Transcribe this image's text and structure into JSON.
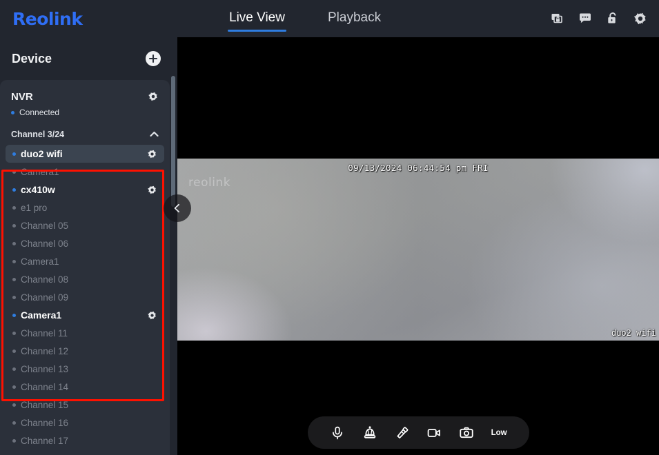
{
  "app": {
    "logo_text": "Reolink"
  },
  "header": {
    "tabs": [
      {
        "label": "Live View",
        "active": true
      },
      {
        "label": "Playback",
        "active": false
      }
    ],
    "icons": [
      {
        "name": "screen-lock-icon"
      },
      {
        "name": "chat-bubble-icon"
      },
      {
        "name": "unlocked-padlock-icon"
      },
      {
        "name": "gear-icon"
      }
    ]
  },
  "sidebar": {
    "title": "Device",
    "add_button_label": "+",
    "nvr": {
      "name": "NVR",
      "status": "Connected",
      "status_online": true
    },
    "channel_group": {
      "label": "Channel 3/24",
      "expanded": true
    },
    "channels": [
      {
        "label": "duo2 wifi",
        "active": true,
        "selected": true,
        "gear": true
      },
      {
        "label": "Camera1",
        "active": false,
        "selected": false,
        "gear": false
      },
      {
        "label": "cx410w",
        "active": true,
        "selected": false,
        "gear": true
      },
      {
        "label": "e1 pro",
        "active": false,
        "selected": false,
        "gear": false
      },
      {
        "label": "Channel 05",
        "active": false,
        "selected": false,
        "gear": false
      },
      {
        "label": "Channel 06",
        "active": false,
        "selected": false,
        "gear": false
      },
      {
        "label": "Camera1",
        "active": false,
        "selected": false,
        "gear": false
      },
      {
        "label": "Channel 08",
        "active": false,
        "selected": false,
        "gear": false
      },
      {
        "label": "Channel 09",
        "active": false,
        "selected": false,
        "gear": false
      },
      {
        "label": "Camera1",
        "active": true,
        "selected": false,
        "gear": true
      },
      {
        "label": "Channel 11",
        "active": false,
        "selected": false,
        "gear": false
      },
      {
        "label": "Channel 12",
        "active": false,
        "selected": false,
        "gear": false
      },
      {
        "label": "Channel 13",
        "active": false,
        "selected": false,
        "gear": false
      },
      {
        "label": "Channel 14",
        "active": false,
        "selected": false,
        "gear": false
      },
      {
        "label": "Channel 15",
        "active": false,
        "selected": false,
        "gear": false
      },
      {
        "label": "Channel 16",
        "active": false,
        "selected": false,
        "gear": false
      },
      {
        "label": "Channel 17",
        "active": false,
        "selected": false,
        "gear": false
      }
    ]
  },
  "video": {
    "timestamp": "09/13/2024 06:44:54 pm FRI",
    "channel_name": "duo2 wifi",
    "watermark": "reolink"
  },
  "toolbar": {
    "buttons": [
      {
        "name": "microphone-icon"
      },
      {
        "name": "siren-alarm-icon"
      },
      {
        "name": "flashlight-icon"
      },
      {
        "name": "video-record-icon"
      },
      {
        "name": "snapshot-camera-icon"
      }
    ],
    "quality_label": "Low"
  },
  "colors": {
    "accent": "#2f7de0",
    "logo": "#2f6ef5",
    "annotation": "#fe1100",
    "sidebar_bg": "#22262f",
    "card_bg": "#2b303a"
  }
}
